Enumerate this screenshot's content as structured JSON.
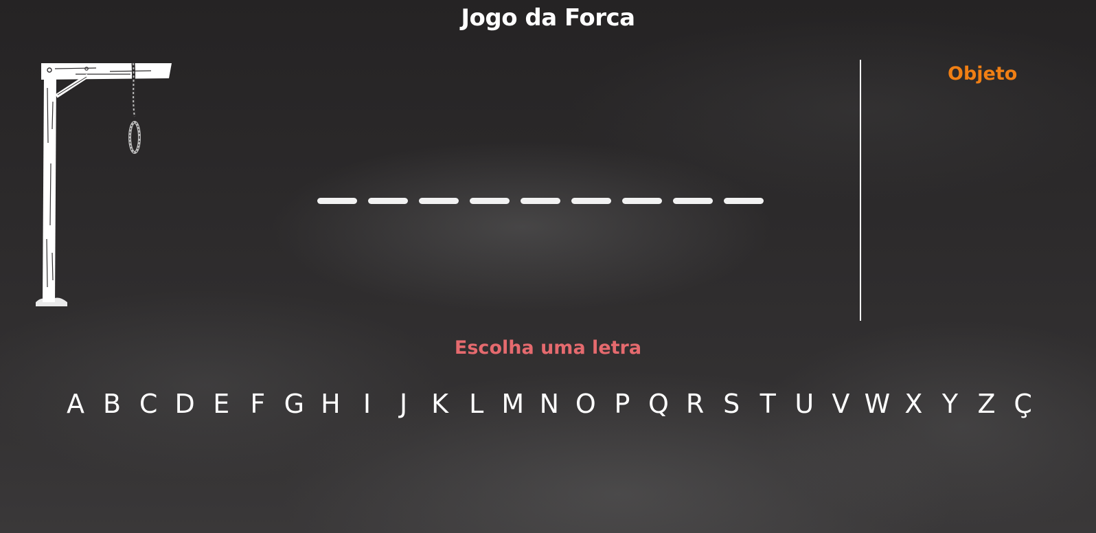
{
  "game": {
    "title": "Jogo da Forca",
    "category": "Objeto",
    "prompt": "Escolha uma letra",
    "word_length": 9
  },
  "alphabet": [
    "A",
    "B",
    "C",
    "D",
    "E",
    "F",
    "G",
    "H",
    "I",
    "J",
    "K",
    "L",
    "M",
    "N",
    "O",
    "P",
    "Q",
    "R",
    "S",
    "T",
    "U",
    "V",
    "W",
    "X",
    "Y",
    "Z",
    "Ç"
  ],
  "colors": {
    "background": "#2d2b2c",
    "title": "#ffffff",
    "category": "#f07f14",
    "prompt": "#e56a6e",
    "letters": "#ffffff"
  },
  "icons": {
    "gallows": "gallows-icon",
    "noose": "noose-icon"
  }
}
